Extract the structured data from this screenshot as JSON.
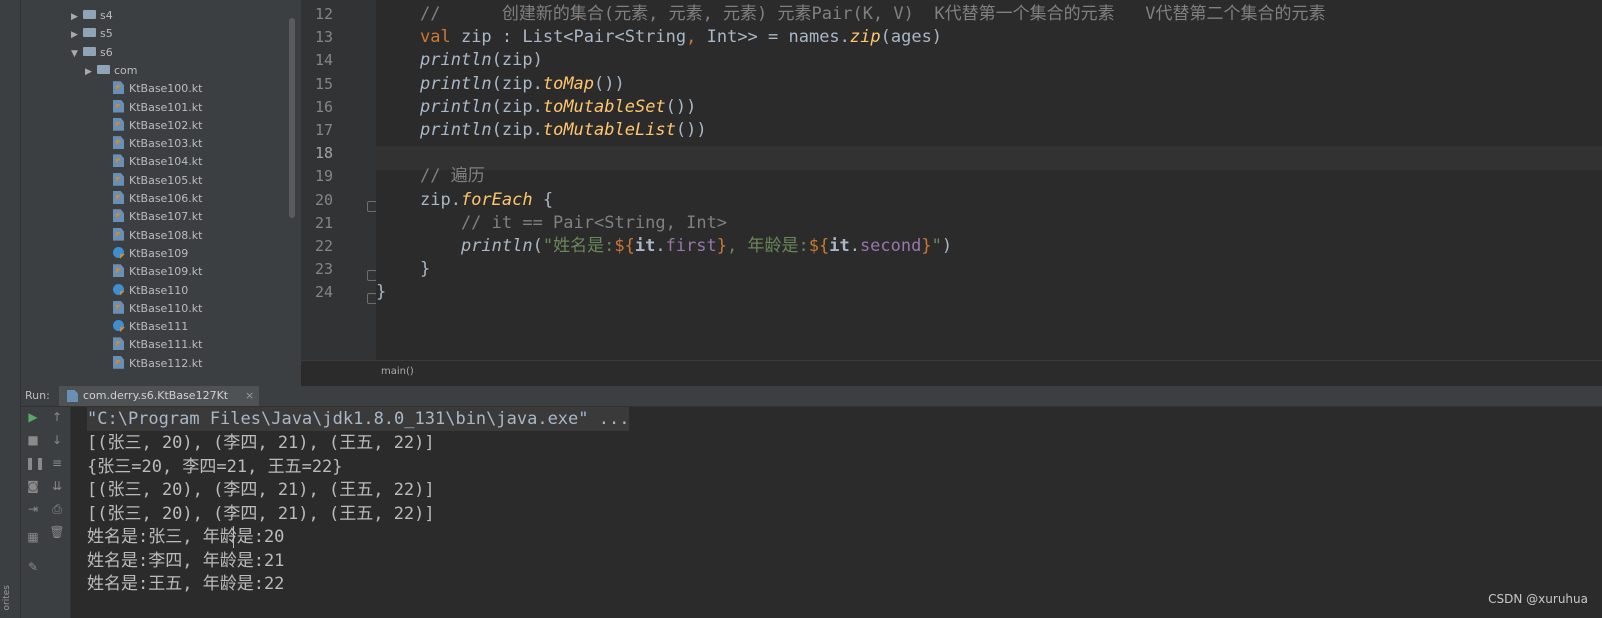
{
  "project_tree": [
    {
      "label": "s4",
      "kind": "folder",
      "arrow": "▶",
      "indent": 1
    },
    {
      "label": "s5",
      "kind": "folder",
      "arrow": "▶",
      "indent": 1
    },
    {
      "label": "s6",
      "kind": "folder",
      "arrow": "▼",
      "indent": 1
    },
    {
      "label": "com",
      "kind": "folder",
      "arrow": "▶",
      "indent": 2
    },
    {
      "label": "KtBase100.kt",
      "kind": "file",
      "indent": 3
    },
    {
      "label": "KtBase101.kt",
      "kind": "file",
      "indent": 3
    },
    {
      "label": "KtBase102.kt",
      "kind": "file",
      "indent": 3
    },
    {
      "label": "KtBase103.kt",
      "kind": "file",
      "indent": 3
    },
    {
      "label": "KtBase104.kt",
      "kind": "file",
      "indent": 3
    },
    {
      "label": "KtBase105.kt",
      "kind": "file",
      "indent": 3
    },
    {
      "label": "KtBase106.kt",
      "kind": "file",
      "indent": 3
    },
    {
      "label": "KtBase107.kt",
      "kind": "file",
      "indent": 3
    },
    {
      "label": "KtBase108.kt",
      "kind": "file",
      "indent": 3
    },
    {
      "label": "KtBase109",
      "kind": "class",
      "indent": 3
    },
    {
      "label": "KtBase109.kt",
      "kind": "file",
      "indent": 3
    },
    {
      "label": "KtBase110",
      "kind": "class",
      "indent": 3
    },
    {
      "label": "KtBase110.kt",
      "kind": "file",
      "indent": 3
    },
    {
      "label": "KtBase111",
      "kind": "class",
      "indent": 3
    },
    {
      "label": "KtBase111.kt",
      "kind": "file",
      "indent": 3
    },
    {
      "label": "KtBase112.kt",
      "kind": "file",
      "indent": 3
    }
  ],
  "editor": {
    "line_numbers": [
      "12",
      "13",
      "14",
      "15",
      "16",
      "17",
      "18",
      "19",
      "20",
      "21",
      "22",
      "23",
      "24"
    ],
    "current_line": "18",
    "lines": [
      [
        {
          "t": "//      创建新的集合(元素, 元素, 元素) 元素Pair(K, V)  K代替第一个集合的元素   V代替第二个集合的元素",
          "c": "cm"
        }
      ],
      [
        {
          "t": "val ",
          "c": "kw"
        },
        {
          "t": "zip : List<Pair<String",
          "c": ""
        },
        {
          "t": ",",
          "c": "kw"
        },
        {
          "t": " Int>> = names.",
          "c": ""
        },
        {
          "t": "zip",
          "c": "ext"
        },
        {
          "t": "(ages)",
          "c": ""
        }
      ],
      [
        {
          "t": "println",
          "c": "fn"
        },
        {
          "t": "(zip)",
          "c": ""
        }
      ],
      [
        {
          "t": "println",
          "c": "fn"
        },
        {
          "t": "(zip.",
          "c": ""
        },
        {
          "t": "toMap",
          "c": "ext"
        },
        {
          "t": "())",
          "c": ""
        }
      ],
      [
        {
          "t": "println",
          "c": "fn"
        },
        {
          "t": "(zip.",
          "c": ""
        },
        {
          "t": "toMutableSet",
          "c": "ext"
        },
        {
          "t": "())",
          "c": ""
        }
      ],
      [
        {
          "t": "println",
          "c": "fn"
        },
        {
          "t": "(zip.",
          "c": ""
        },
        {
          "t": "toMutableList",
          "c": "ext"
        },
        {
          "t": "())",
          "c": ""
        }
      ],
      [],
      [
        {
          "t": "// 遍历",
          "c": "cm"
        }
      ],
      [
        {
          "t": "zip.",
          "c": ""
        },
        {
          "t": "forEach",
          "c": "ext"
        },
        {
          "t": " {",
          "c": ""
        }
      ],
      [
        {
          "t": "    // it == Pair<String, Int>",
          "c": "cm"
        }
      ],
      [
        {
          "t": "    ",
          "c": ""
        },
        {
          "t": "println",
          "c": "fn"
        },
        {
          "t": "(",
          "c": ""
        },
        {
          "t": "\"姓名是:",
          "c": "str"
        },
        {
          "t": "${",
          "c": "tpl"
        },
        {
          "t": "it",
          "c": "it"
        },
        {
          "t": ".",
          "c": ""
        },
        {
          "t": "first",
          "c": "prop"
        },
        {
          "t": "}",
          "c": "tpl"
        },
        {
          "t": ", 年龄是:",
          "c": "str"
        },
        {
          "t": "${",
          "c": "tpl"
        },
        {
          "t": "it",
          "c": "it"
        },
        {
          "t": ".",
          "c": ""
        },
        {
          "t": "second",
          "c": "prop"
        },
        {
          "t": "}",
          "c": "tpl"
        },
        {
          "t": "\"",
          "c": "str"
        },
        {
          "t": ")",
          "c": ""
        }
      ],
      [
        {
          "t": "}",
          "c": ""
        }
      ],
      [
        {
          "t": "}",
          "c": ""
        }
      ]
    ],
    "indent_levels": [
      1,
      1,
      1,
      1,
      1,
      1,
      1,
      1,
      1,
      1,
      1,
      1,
      0
    ]
  },
  "breadcrumb": "main()",
  "run_panel": {
    "label": "Run:",
    "tab_title": "com.derry.s6.KtBase127Kt",
    "tab_close": "×"
  },
  "console": {
    "command": "\"C:\\Program Files\\Java\\jdk1.8.0_131\\bin\\java.exe\" ...",
    "output": [
      "[(张三, 20), (李四, 21), (王五, 22)]",
      "{张三=20, 李四=21, 王五=22}",
      "[(张三, 20), (李四, 21), (王五, 22)]",
      "[(张三, 20), (李四, 21), (王五, 22)]",
      "姓名是:张三, 年龄是:20",
      "姓名是:李四, 年龄是:21",
      "姓名是:王五, 年龄是:22"
    ]
  },
  "left_strip_label": "orites",
  "watermark": "CSDN @xuruhua"
}
